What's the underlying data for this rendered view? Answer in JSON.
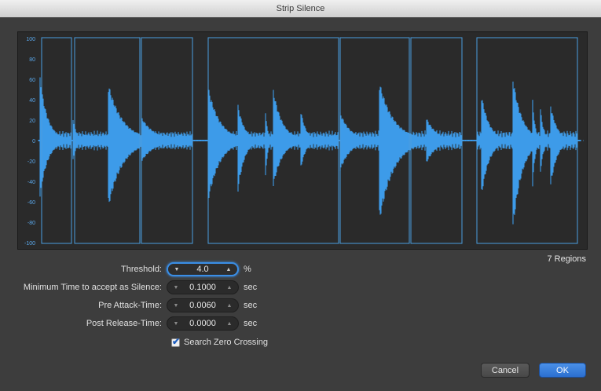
{
  "window": {
    "title": "Strip Silence"
  },
  "waveform": {
    "y_ticks": [
      "100",
      "80",
      "60",
      "40",
      "20",
      "0",
      "-20",
      "-40",
      "-60",
      "-80",
      "-100"
    ],
    "regions_label": "7 Regions",
    "colors": {
      "wave": "#3d9be9",
      "region_border": "#4a9ee0",
      "background": "#2a2a2a"
    }
  },
  "fields": [
    {
      "label": "Threshold:",
      "value": "4.0",
      "unit": "%",
      "focused": true
    },
    {
      "label": "Minimum Time to accept as Silence:",
      "value": "0.1000",
      "unit": "sec",
      "focused": false
    },
    {
      "label": "Pre Attack-Time:",
      "value": "0.0060",
      "unit": "sec",
      "focused": false
    },
    {
      "label": "Post Release-Time:",
      "value": "0.0000",
      "unit": "sec",
      "focused": false
    }
  ],
  "checkbox": {
    "label": "Search Zero Crossing",
    "checked": true
  },
  "buttons": {
    "cancel": "Cancel",
    "ok": "OK"
  },
  "icons": {
    "down_arrow": "▼",
    "up_arrow": "▲",
    "check": "✔"
  }
}
